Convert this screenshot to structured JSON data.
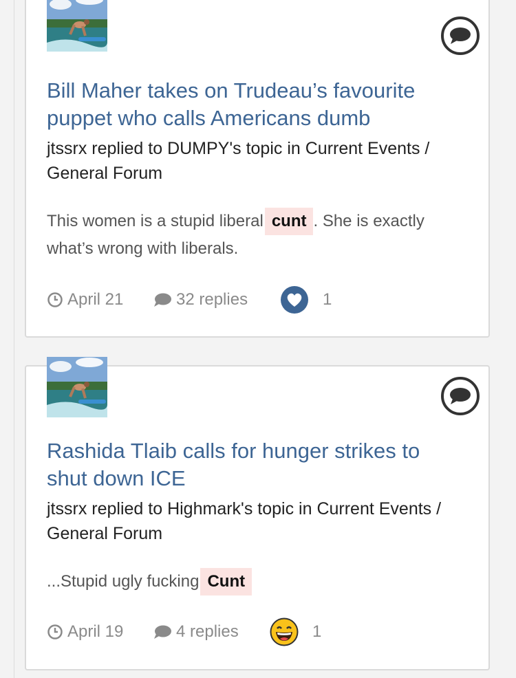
{
  "feed": {
    "items": [
      {
        "title": "Bill Maher takes on Trudeau’s favourite puppet who calls Americans dumb",
        "meta": {
          "user": "jtssrx",
          "action": " replied to ",
          "topic_owner": "DUMPY's topic",
          "preposition": " in ",
          "forum": "Current Events / General Forum"
        },
        "snippet": {
          "before": "This women is a stupid liberal",
          "censored": "cunt",
          "after": ". She is exactly what’s wrong with liberals."
        },
        "date": "April 21",
        "replies": "32 replies",
        "reaction": {
          "icon": "like-heart-icon",
          "count": "1"
        }
      },
      {
        "title": "Rashida Tlaib calls for hunger strikes to shut down ICE",
        "meta": {
          "user": "jtssrx",
          "action": " replied to ",
          "topic_owner": "Highmark's topic",
          "preposition": " in ",
          "forum": "Current Events / General Forum"
        },
        "snippet": {
          "before": "...Stupid ugly fucking",
          "censored": "Cunt",
          "after": ""
        },
        "date": "April 19",
        "replies": "4 replies",
        "reaction": {
          "icon": "laughing-emoji-icon",
          "count": "1"
        }
      }
    ]
  },
  "colors": {
    "title_link": "#3d6594",
    "censor_bg": "#fbe3e1",
    "muted_text": "#8a8a8a",
    "like_blue": "#3d6594"
  }
}
